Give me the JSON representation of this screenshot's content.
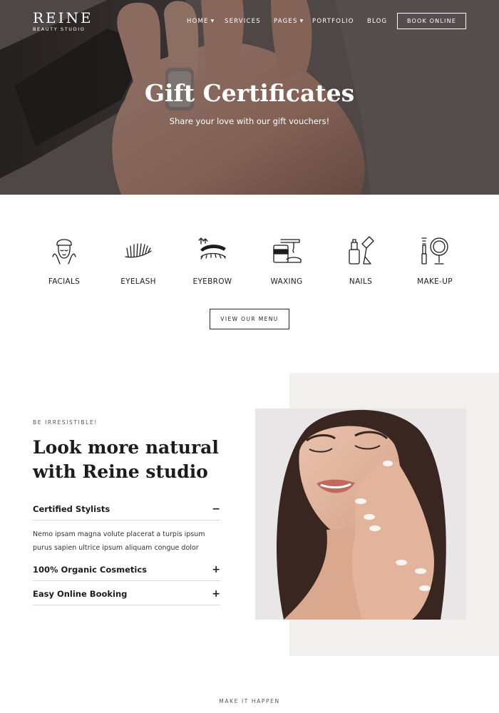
{
  "brand": {
    "name": "REINE",
    "tagline": "BEAUTY STUDIO"
  },
  "nav": {
    "items": [
      {
        "label": "HOME",
        "has_dropdown": true
      },
      {
        "label": "SERVICES",
        "has_dropdown": false
      },
      {
        "label": "PAGES",
        "has_dropdown": true
      },
      {
        "label": "PORTFOLIO",
        "has_dropdown": false
      },
      {
        "label": "BLOG",
        "has_dropdown": false
      }
    ],
    "cta": "BOOK ONLINE"
  },
  "hero": {
    "title": "Gift Certificates",
    "subtitle": "Share your love with our gift vouchers!"
  },
  "services": {
    "items": [
      {
        "label": "FACIALS",
        "icon": "facial-icon"
      },
      {
        "label": "EYELASH",
        "icon": "eyelash-icon"
      },
      {
        "label": "EYEBROW",
        "icon": "eyebrow-icon"
      },
      {
        "label": "WAXING",
        "icon": "waxing-icon"
      },
      {
        "label": "NAILS",
        "icon": "nail-polish-icon"
      },
      {
        "label": "MAKE-UP",
        "icon": "makeup-mirror-icon"
      }
    ],
    "button": "VIEW OUR MENU"
  },
  "about": {
    "eyebrow": "BE IRRESISTIBLE!",
    "title": "Look more natural with Reine studio",
    "accordion": [
      {
        "title": "Certified Stylists",
        "expanded": true,
        "sign": "−",
        "body": "Nemo ipsam magna volute placerat a turpis ipsum purus sapien ultrice ipsum aliquam congue dolor"
      },
      {
        "title": "100% Organic Cosmetics",
        "expanded": false,
        "sign": "+"
      },
      {
        "title": "Easy Online Booking",
        "expanded": false,
        "sign": "+"
      }
    ]
  },
  "next_section": {
    "eyebrow": "MAKE IT HAPPEN"
  },
  "colors": {
    "text": "#1c1c1c",
    "panel": "#f1f0ee",
    "divider": "#d9d9d9",
    "hero_overlay": "#2a2422"
  }
}
